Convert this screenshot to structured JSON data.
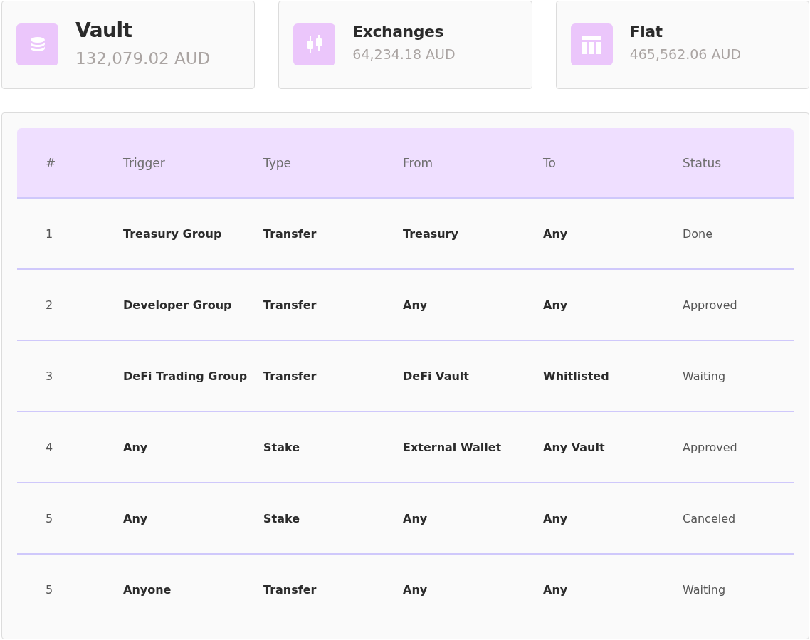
{
  "cards": [
    {
      "title": "Vault",
      "amount": "132,079.02 AUD",
      "selected": true
    },
    {
      "title": "Exchanges",
      "amount": "64,234.18 AUD",
      "selected": false
    },
    {
      "title": "Fiat",
      "amount": "465,562.06 AUD",
      "selected": false
    }
  ],
  "table": {
    "columns": [
      "#",
      "Trigger",
      "Type",
      "From",
      "To",
      "Status"
    ],
    "rows": [
      [
        "1",
        "Treasury Group",
        "Transfer",
        "Treasury",
        "Any",
        "Done"
      ],
      [
        "2",
        "Developer Group",
        "Transfer",
        "Any",
        "Any",
        "Approved"
      ],
      [
        "3",
        "DeFi Trading Group",
        "Transfer",
        "DeFi Vault",
        "Whitlisted",
        "Waiting"
      ],
      [
        "4",
        "Any",
        "Stake",
        "External Wallet",
        "Any Vault",
        "Approved"
      ],
      [
        "5",
        "Any",
        "Stake",
        "Any",
        "Any",
        "Canceled"
      ],
      [
        "5",
        "Anyone",
        "Transfer",
        "Any",
        "Any",
        "Waiting"
      ]
    ]
  }
}
